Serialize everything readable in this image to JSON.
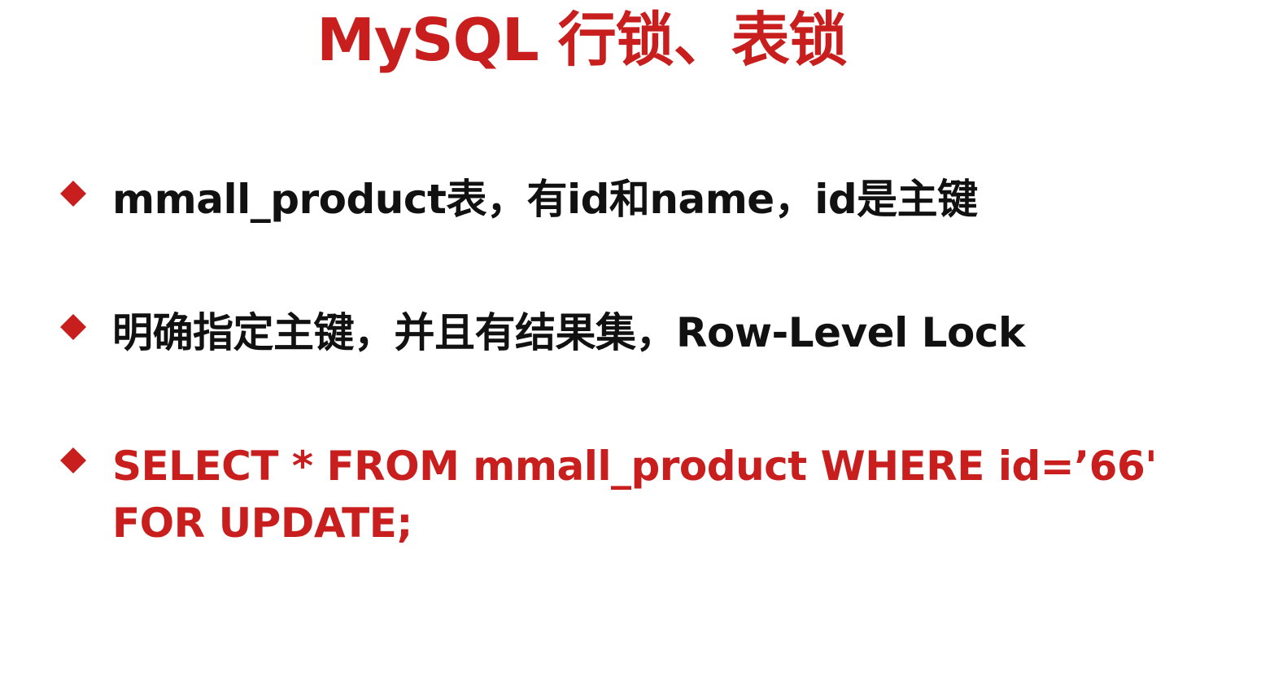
{
  "slide": {
    "title": "MySQL 行锁、表锁",
    "bullets": [
      {
        "text": "mmall_product表，有id和name，id是主键",
        "style": "dark"
      },
      {
        "text": "明确指定主键，并且有结果集，Row-Level Lock",
        "style": "dark"
      },
      {
        "text": "SELECT * FROM mmall_product WHERE id=’66' FOR UPDATE;",
        "style": "accent"
      }
    ]
  },
  "colors": {
    "accent": "#c81e1e",
    "text": "#111111",
    "background": "#ffffff"
  },
  "icons": {
    "bullet": "red-diamond-icon"
  }
}
